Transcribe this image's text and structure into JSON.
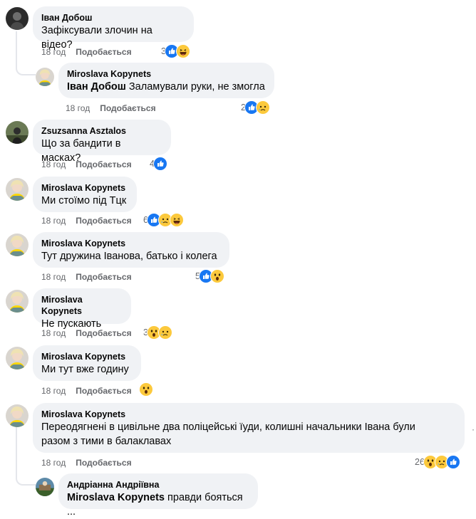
{
  "comments": [
    {
      "author": "Іван Добош",
      "text": "Зафіксували злочин на відео?",
      "time": "18 год",
      "like": "Подобається",
      "reaction_count": "3",
      "reactions": [
        "like-icon",
        "haha-icon"
      ]
    },
    {
      "author": "Miroslava Kopynets",
      "mention": "Іван Добош",
      "text": "Заламували руки, не змогла",
      "time": "18 год",
      "like": "Подобається",
      "reaction_count": "2",
      "reactions": [
        "like-icon",
        "sad-icon"
      ]
    },
    {
      "author": "Zsuzsanna Asztalos",
      "text": "Що за бандити в масках?",
      "time": "18 год",
      "like": "Подобається",
      "reaction_count": "4",
      "reactions": [
        "like-icon"
      ]
    },
    {
      "author": "Miroslava Kopynets",
      "text": "Ми стоїмо під Тцк",
      "time": "18 год",
      "like": "Подобається",
      "reaction_count": "6",
      "reactions": [
        "like-icon",
        "sad-icon",
        "haha-icon"
      ]
    },
    {
      "author": "Miroslava Kopynets",
      "text": "Тут дружина Іванова, батько і колега",
      "time": "18 год",
      "like": "Подобається",
      "reaction_count": "5",
      "reactions": [
        "like-icon",
        "wow-icon"
      ]
    },
    {
      "author": "Miroslava Kopynets",
      "text": "Не пускають",
      "time": "18 год",
      "like": "Подобається",
      "reaction_count": "3",
      "reactions": [
        "wow-icon",
        "sad-icon"
      ]
    },
    {
      "author": "Miroslava Kopynets",
      "text": "Ми тут вже годину",
      "time": "18 год",
      "like": "Подобається",
      "reaction_count": "",
      "reactions": [
        "wow-icon"
      ]
    },
    {
      "author": "Miroslava Kopynets",
      "text_line1": "Переодягнені в цивільне два поліцейські їуди, колишні начальники Івана були",
      "text_line2": "разом з тими в балаклавах",
      "time": "18 год",
      "like": "Подобається",
      "reaction_count": "26",
      "reactions": [
        "wow-icon",
        "sad-icon",
        "like-icon"
      ]
    },
    {
      "author": "Андріанна Андріївна",
      "mention": "Miroslava Kopynets",
      "text": "правди бояться ...",
      "time": "",
      "like": "",
      "reaction_count": "",
      "reactions": []
    }
  ],
  "colors": {
    "like": "#1877f2",
    "bubble": "#f0f2f5",
    "meta": "#65676b",
    "emoji": "#fcc93c"
  }
}
